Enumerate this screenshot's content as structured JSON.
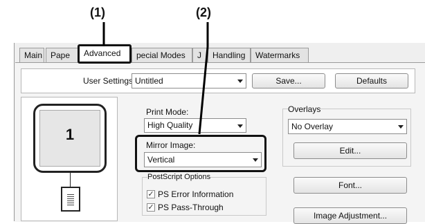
{
  "callouts": {
    "one": "(1)",
    "two": "(2)"
  },
  "tabs": [
    {
      "label": "Main"
    },
    {
      "label": "Pape"
    },
    {
      "label": "Advanced"
    },
    {
      "label": "pecial Modes"
    },
    {
      "label": "J"
    },
    {
      "label": "Handling"
    },
    {
      "label": "Watermarks"
    }
  ],
  "user_settings": {
    "label": "User Settings:",
    "value": "Untitled",
    "save_label": "Save...",
    "defaults_label": "Defaults"
  },
  "preview": {
    "page_number": "1"
  },
  "print_mode": {
    "label": "Print Mode:",
    "value": "High Quality"
  },
  "mirror_image": {
    "label": "Mirror Image:",
    "value": "Vertical"
  },
  "postscript": {
    "group_label": "PostScript Options",
    "ps_error_label": "PS Error Information",
    "ps_error_checked": true,
    "ps_passthrough_label": "PS Pass-Through",
    "ps_passthrough_checked": true
  },
  "overlays": {
    "group_label": "Overlays",
    "value": "No Overlay",
    "edit_label": "Edit..."
  },
  "font_button_label": "Font...",
  "image_adjustment_label": "Image Adjustment...",
  "colors": {
    "highlight_border": "#111111"
  }
}
